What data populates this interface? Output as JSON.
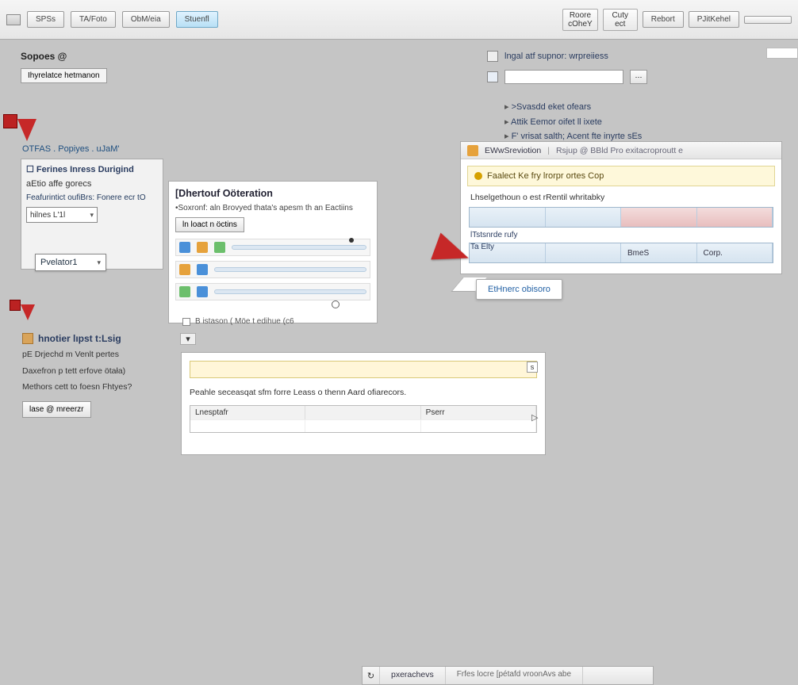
{
  "toolbar": {
    "left": [
      "SPSs",
      "TA/Foto",
      "ObM/eia",
      "Stuenfl"
    ],
    "right_groups": [
      {
        "l1": "Roore",
        "l2": "cOheY"
      },
      {
        "l1": "Cuty",
        "l2": "ect"
      }
    ],
    "right_buttons": [
      "Rebort",
      "PJitKehel",
      ""
    ]
  },
  "sources": {
    "label": "Sopoes @",
    "sub_button": "Ihyrelatce hetmanon"
  },
  "crumb": "OTFAS . Popiyes . uJaM'",
  "panel1": {
    "title": "Ferines Inress Durigind",
    "sub": "aEtio affe gorecs",
    "line2": "Feafurintict oufiBrs: Fonere ecr tO",
    "combo1": "hilnes L'1l",
    "combo2": "Pvelator1"
  },
  "panel2": {
    "title": "hnotier lıpst t:Lsig",
    "lines": [
      "pE Drjechd m Venlt pertes",
      "Daxefron p tett erfove ötała)",
      "Methors cett to foesn Fhtyes?"
    ],
    "button": "lase @ mreerzr"
  },
  "mid": {
    "title": "[Dhertouf Oöteration",
    "desc": "•Soxronf: aln Brovyed thata's apesm th an Eactiins",
    "btn": "ln loact n öctins",
    "footer": "B  istason ( Möe t edihue (c6"
  },
  "tabs": {
    "active": "pxerachevs",
    "extra": "Frfes locre [pétafd vroonAvs abe"
  },
  "bottom": {
    "desc": "Peahle seceasqat sfm forre Leass o thenn Aard ofiarecors.",
    "headers": [
      "Lnesptafr",
      "",
      "Pserr"
    ]
  },
  "right_strip": {
    "hdr": "lngal atf supnor:  wrpreiiess",
    "list": [
      ">Svasdd eket ofears",
      "Attik Eemor oifet ll ixete",
      "F' vrisat salth; Acent fte inyrte sEs"
    ]
  },
  "right_panel": {
    "bar_title": "EWwSreviotion",
    "bar_extra": "Rsjup @ BBld Pro exitacroproutt e",
    "yellow": "Faalect Ke fry lrorpr ortes Cop",
    "sub": "Lhselgethoun o est rRentil whritabky",
    "row_a_label": "lTstsnrde rufy",
    "row_b_label": "Ta Elty",
    "row_b_cells": [
      "",
      "",
      "BmeS",
      "Corp."
    ]
  },
  "callout": "EtHnerc obisoro"
}
